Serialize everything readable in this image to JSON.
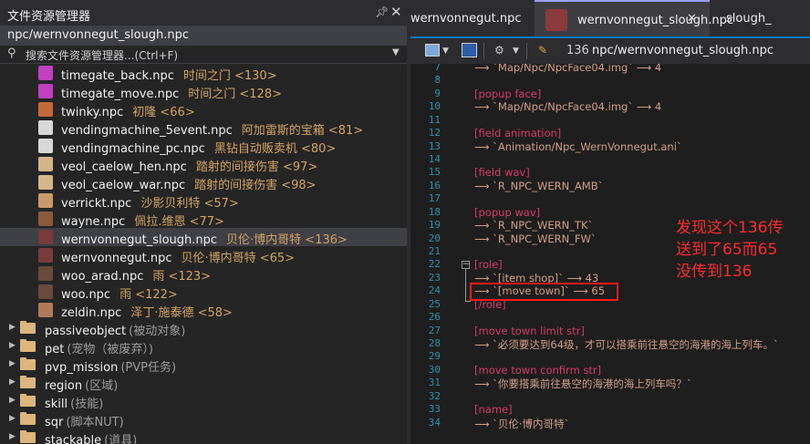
{
  "explorer": {
    "title": "文件资源管理器",
    "pin_icon": "pin-icon",
    "close_icon": "close-icon",
    "current_path": "npc/wernvonnegut_slough.npc",
    "search_placeholder": "搜索文件资源管理器...(Ctrl+F)",
    "files": [
      {
        "name": "timegate_back.npc",
        "desc": "时间之门 <130>",
        "icon_color": "#c040c0"
      },
      {
        "name": "timegate_move.npc",
        "desc": "时间之门 <128>",
        "icon_color": "#c040c0"
      },
      {
        "name": "twinky.npc",
        "desc": "初隆 <66>",
        "icon_color": "#c46a3a"
      },
      {
        "name": "vendingmachine_5event.npc",
        "desc": "阿加雷斯的宝箱 <81>",
        "icon_color": "#d8d8d8"
      },
      {
        "name": "vendingmachine_pc.npc",
        "desc": "黑钻自动贩卖机 <80>",
        "icon_color": "#d8d8d8"
      },
      {
        "name": "veol_caelow_hen.npc",
        "desc": "踏射的间接伤害 <97>",
        "icon_color": "#d6b48a"
      },
      {
        "name": "veol_caelow_war.npc",
        "desc": "踏射的间接伤害 <98>",
        "icon_color": "#d6b48a"
      },
      {
        "name": "verrickt.npc",
        "desc": "沙影贝利特 <57>",
        "icon_color": "#c89a6a"
      },
      {
        "name": "wayne.npc",
        "desc": "佩拉.维恩 <77>",
        "icon_color": "#8a5a3a"
      },
      {
        "name": "wernvonnegut_slough.npc",
        "desc": "贝伦·博内哥特 <136>",
        "icon_color": "#7a3b3b"
      },
      {
        "name": "wernvonnegut.npc",
        "desc": "贝伦·博内哥特 <65>",
        "icon_color": "#7a3b3b"
      },
      {
        "name": "woo_arad.npc",
        "desc": "雨 <123>",
        "icon_color": "#6a4a3a"
      },
      {
        "name": "woo.npc",
        "desc": "雨 <122>",
        "icon_color": "#6a4a3a"
      },
      {
        "name": "zeldin.npc",
        "desc": "泽丁·施泰德 <58>",
        "icon_color": "#b07a5a"
      }
    ],
    "folders": [
      {
        "name": "passiveobject",
        "desc": "(被动对象)"
      },
      {
        "name": "pet",
        "desc": "(宠物（被废弃）)"
      },
      {
        "name": "pvp_mission",
        "desc": "(PVP任务)"
      },
      {
        "name": "region",
        "desc": "(区域)"
      },
      {
        "name": "skill",
        "desc": "(技能)"
      },
      {
        "name": "sqr",
        "desc": "(脚本NUT)"
      },
      {
        "name": "stackable",
        "desc": "(道具)"
      }
    ]
  },
  "tabs": [
    {
      "label": "wernvonnegut.npc"
    },
    {
      "label": "wernvonnegut_slough.npc"
    },
    {
      "label": "slough_"
    }
  ],
  "toolbar": {
    "number": "136",
    "path": "npc/wernvonnegut_slough.npc"
  },
  "code_lines": [
    {
      "n": "7",
      "text": "⟶ `Map/Npc/NpcFace04.img` ⟶ 4"
    },
    {
      "n": "8",
      "text": ""
    },
    {
      "n": "9",
      "text": "[popup face]"
    },
    {
      "n": "10",
      "text": "⟶ `Map/Npc/NpcFace04.img` ⟶ 4"
    },
    {
      "n": "11",
      "text": ""
    },
    {
      "n": "12",
      "text": "[field animation]"
    },
    {
      "n": "13",
      "text": "⟶ `Animation/Npc_WernVonnegut.ani`"
    },
    {
      "n": "14",
      "text": ""
    },
    {
      "n": "15",
      "text": "[field wav]"
    },
    {
      "n": "16",
      "text": "⟶ `R_NPC_WERN_AMB`"
    },
    {
      "n": "17",
      "text": ""
    },
    {
      "n": "18",
      "text": "[popup wav]"
    },
    {
      "n": "19",
      "text": "⟶ `R_NPC_WERN_TK`"
    },
    {
      "n": "20",
      "text": "⟶ `R_NPC_WERN_FW`"
    },
    {
      "n": "21",
      "text": ""
    },
    {
      "n": "22",
      "text": "[role]"
    },
    {
      "n": "23",
      "text": "⟶ `[item shop]` ⟶ 43"
    },
    {
      "n": "24",
      "text": "⟶ `[move town]` ⟶ 65"
    },
    {
      "n": "25",
      "text": "[/role]"
    },
    {
      "n": "26",
      "text": ""
    },
    {
      "n": "27",
      "text": "[move town limit str]"
    },
    {
      "n": "28",
      "text": "⟶ `必须要达到64级，才可以搭乘前往悬空的海港的海上列车。`"
    },
    {
      "n": "29",
      "text": ""
    },
    {
      "n": "30",
      "text": "[move town confirm str]"
    },
    {
      "n": "31",
      "text": "⟶ `你要搭乘前往悬空的海港的海上列车吗？`"
    },
    {
      "n": "32",
      "text": ""
    },
    {
      "n": "33",
      "text": "[name]"
    },
    {
      "n": "34",
      "text": "⟶ `贝伦·博内哥特`"
    }
  ],
  "annotation": {
    "line1": "发现这个136传",
    "line2": "送到了65而65",
    "line3": "没传到136",
    "color": "#ff2a2a"
  }
}
